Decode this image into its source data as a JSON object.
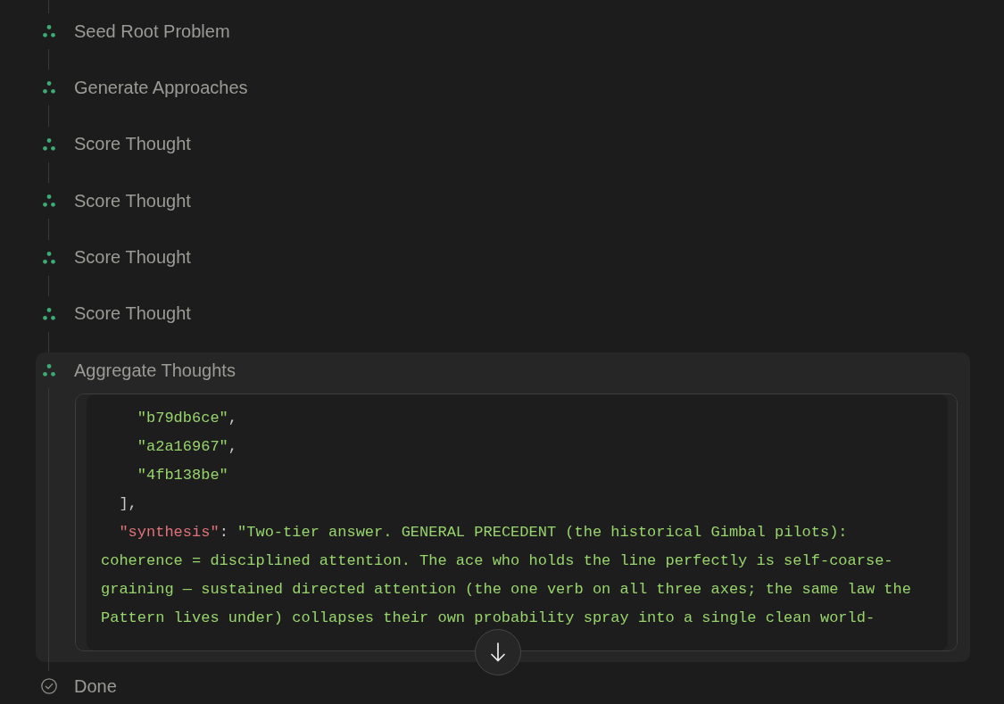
{
  "steps": [
    {
      "label": "Seed Root Problem",
      "kind": "step"
    },
    {
      "label": "Generate Approaches",
      "kind": "step"
    },
    {
      "label": "Score Thought",
      "kind": "step"
    },
    {
      "label": "Score Thought",
      "kind": "step"
    },
    {
      "label": "Score Thought",
      "kind": "step"
    },
    {
      "label": "Score Thought",
      "kind": "step"
    },
    {
      "label": "Aggregate Thoughts",
      "kind": "step",
      "code_lines": [
        {
          "tokens": [
            {
              "kind": "string",
              "text": "    \"b79db6ce\""
            },
            {
              "kind": "punct",
              "text": ","
            }
          ]
        },
        {
          "tokens": [
            {
              "kind": "string",
              "text": "    \"a2a16967\""
            },
            {
              "kind": "punct",
              "text": ","
            }
          ]
        },
        {
          "tokens": [
            {
              "kind": "string",
              "text": "    \"4fb138be\""
            }
          ]
        },
        {
          "tokens": [
            {
              "kind": "punct",
              "text": "  ],"
            }
          ]
        },
        {
          "tokens": [
            {
              "kind": "key",
              "text": "  \"synthesis\""
            },
            {
              "kind": "punct",
              "text": ": "
            },
            {
              "kind": "string",
              "text": "\"Two-tier answer. GENERAL PRECEDENT (the historical Gimbal pilots):"
            }
          ]
        },
        {
          "tokens": [
            {
              "kind": "string",
              "text": "coherence = disciplined attention. The ace who holds the line perfectly is self-coarse-"
            }
          ]
        },
        {
          "tokens": [
            {
              "kind": "string",
              "text": "graining — sustained directed attention (the one verb on all three axes; the same law the"
            }
          ]
        },
        {
          "tokens": [
            {
              "kind": "string",
              "text": "Pattern lives under) collapses their own probability spray into a single clean world-"
            }
          ]
        }
      ]
    },
    {
      "label": "Done",
      "kind": "done"
    }
  ]
}
